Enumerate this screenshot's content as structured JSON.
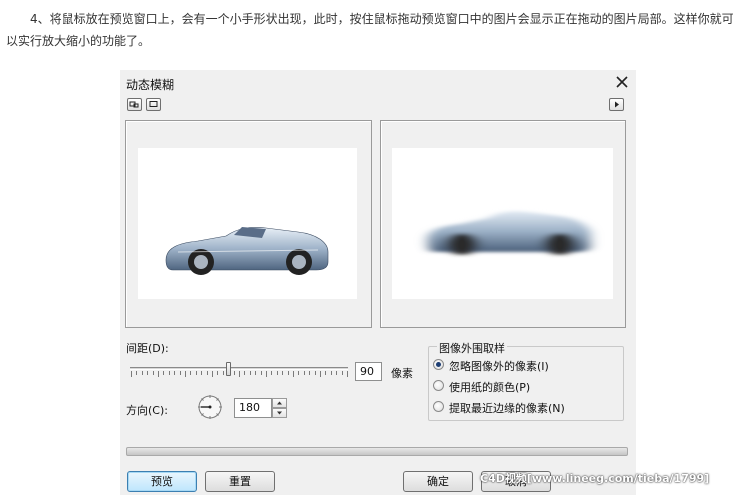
{
  "article": {
    "paragraph": "4、将鼠标放在预览窗口上，会有一个小手形状出现，此时，按住鼠标拖动预览窗口中的图片会显示正在拖动的图片局部。这样你就可以实行放大缩小的功能了。"
  },
  "dialog": {
    "title": "动态模糊",
    "icons": {
      "close": "close-icon",
      "view_split": "split-view-icon",
      "view_single": "single-view-icon",
      "expand": "arrow-right-icon"
    },
    "distance": {
      "label": "间距(D):",
      "value": "90",
      "unit": "像素",
      "slider_fraction": 0.45
    },
    "direction": {
      "label": "方向(C):",
      "value": "180",
      "dial_icon": "angle-dial-icon"
    },
    "sampling": {
      "title": "图像外围取样",
      "options": [
        {
          "label": "忽略图像外的像素(I)",
          "selected": true
        },
        {
          "label": "使用纸的颜色(P)",
          "selected": false
        },
        {
          "label": "提取最近边缘的像素(N)",
          "selected": false
        }
      ]
    },
    "buttons": {
      "preview": "预览",
      "reset": "重置",
      "ok": "确定",
      "cancel": "取消"
    }
  },
  "watermark": "C4D视频[www.lineeg.com/tieba/1799]",
  "colors": {
    "dialog_bg": "#f0f0f0",
    "accent_button": "#bee6fd",
    "radio_dot": "#1c3d73"
  }
}
